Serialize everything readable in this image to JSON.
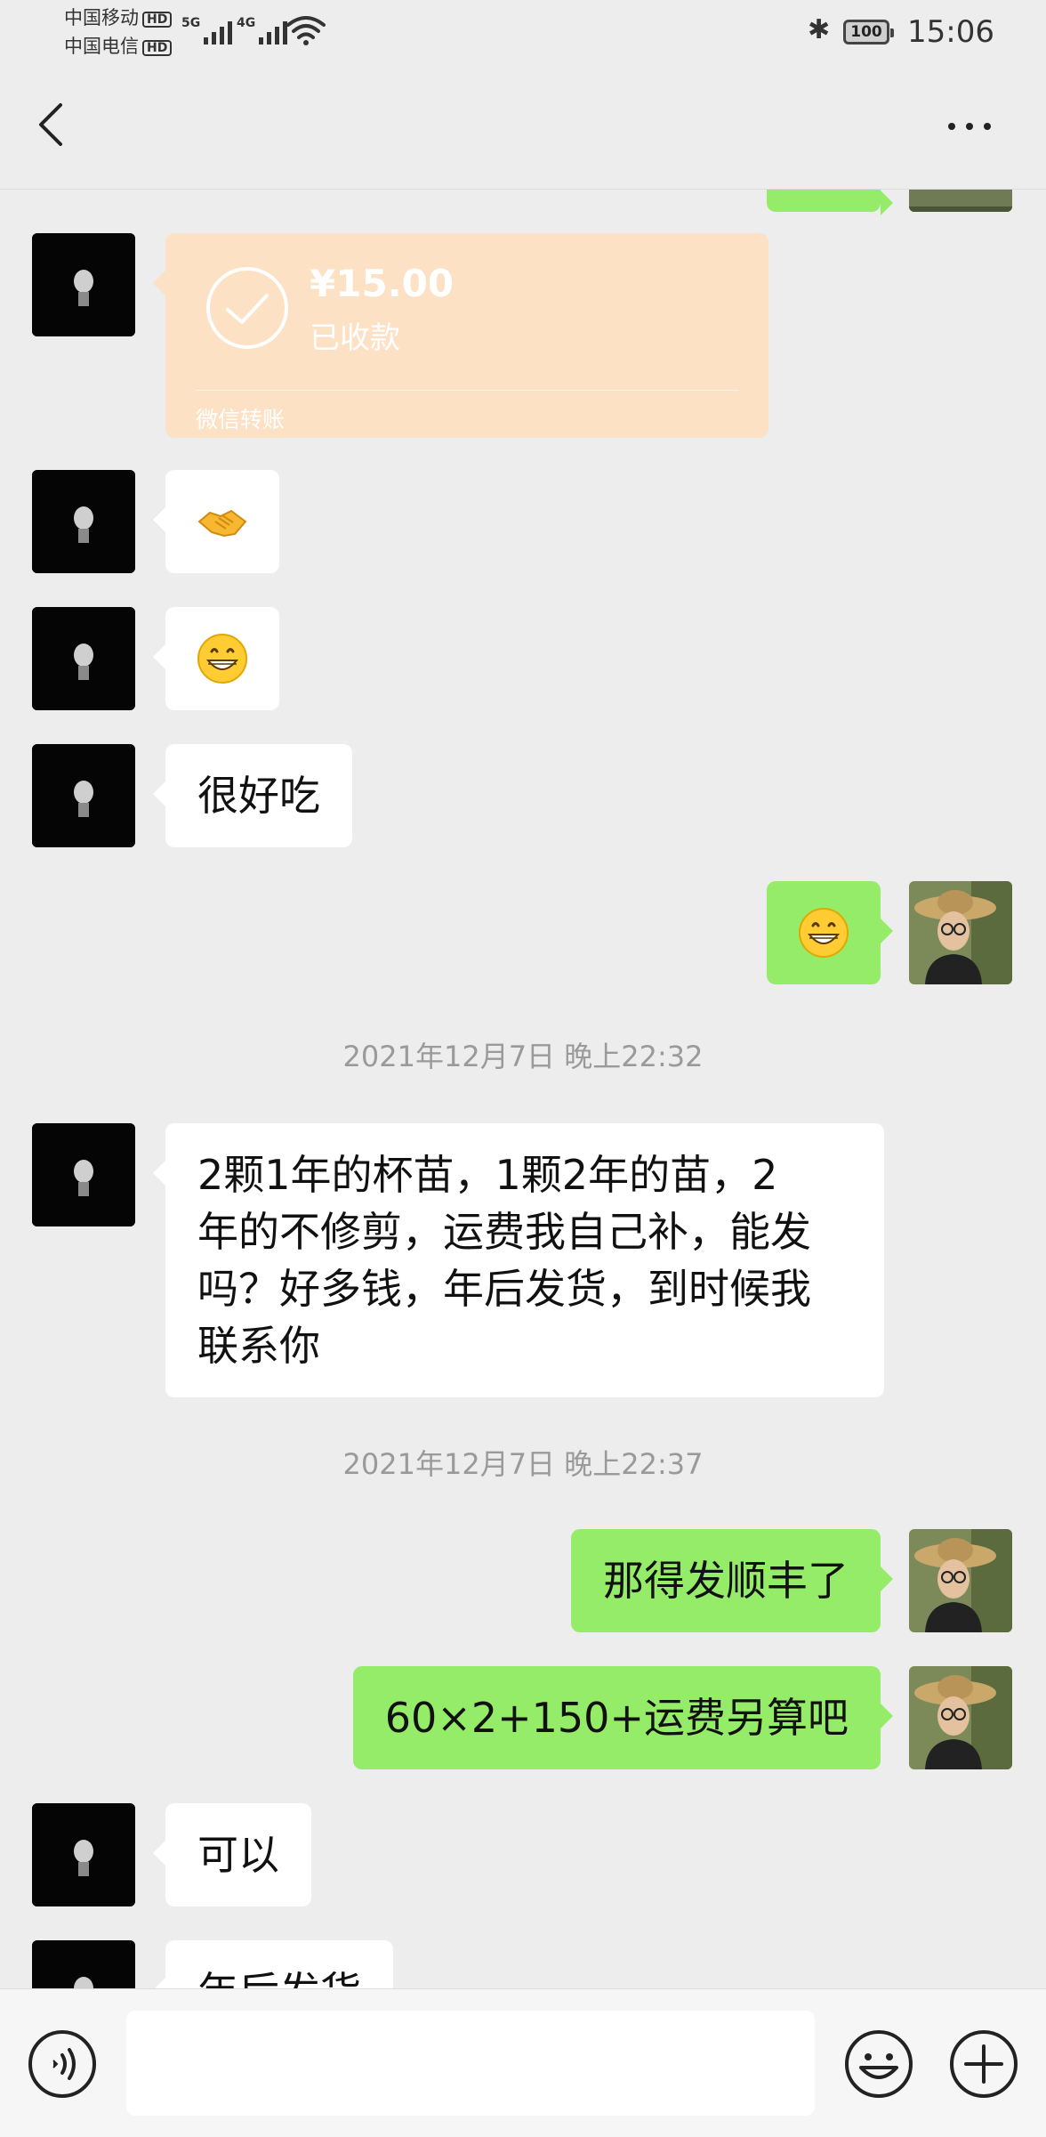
{
  "status_bar": {
    "carrier1": "中国移动",
    "carrier2": "中国电信",
    "hd_badge": "HD",
    "network1": "5G",
    "network2": "4G",
    "battery": "100",
    "time": "15:06"
  },
  "nav": {
    "back_icon": "chevron-left-icon",
    "more_icon": "more-dots-icon"
  },
  "transfer": {
    "amount": "¥15.00",
    "status": "已收款",
    "label": "微信转账"
  },
  "messages": [
    {
      "from": "other",
      "type": "emoji",
      "icon": "handshake-emoji"
    },
    {
      "from": "other",
      "type": "emoji",
      "icon": "grinning-emoji"
    },
    {
      "from": "other",
      "type": "text",
      "text": "很好吃"
    },
    {
      "from": "me",
      "type": "emoji",
      "icon": "grinning-emoji"
    },
    {
      "from": "other",
      "type": "text",
      "text": "2颗1年的杯苗，1颗2年的苗，2年的不修剪，运费我自己补，能发吗？好多钱，年后发货，到时候我联系你"
    },
    {
      "from": "me",
      "type": "text",
      "text": "那得发顺丰了"
    },
    {
      "from": "me",
      "type": "text",
      "text": "60×2+150+运费另算吧"
    },
    {
      "from": "other",
      "type": "text",
      "text": "可以"
    },
    {
      "from": "other",
      "type": "text",
      "text": "年后发货"
    }
  ],
  "timestamps": [
    "2021年12月7日 晚上22:32",
    "2021年12月7日 晚上22:37"
  ],
  "message_lines": {
    "long": [
      "2颗1年的杯苗，1颗2年的苗，2",
      "年的不修剪，运费我自己补，能发",
      "吗？好多钱，年后发货，到时候我",
      "联系你"
    ]
  },
  "input_bar": {
    "voice_icon": "voice-icon",
    "input_value": "",
    "emoji_icon": "smiley-icon",
    "plus_icon": "plus-icon"
  },
  "colors": {
    "background": "#ededed",
    "my_bubble": "#95ec69",
    "their_bubble": "#ffffff",
    "transfer_card": "#fde1c4",
    "timestamp_text": "#9a9a9a"
  }
}
